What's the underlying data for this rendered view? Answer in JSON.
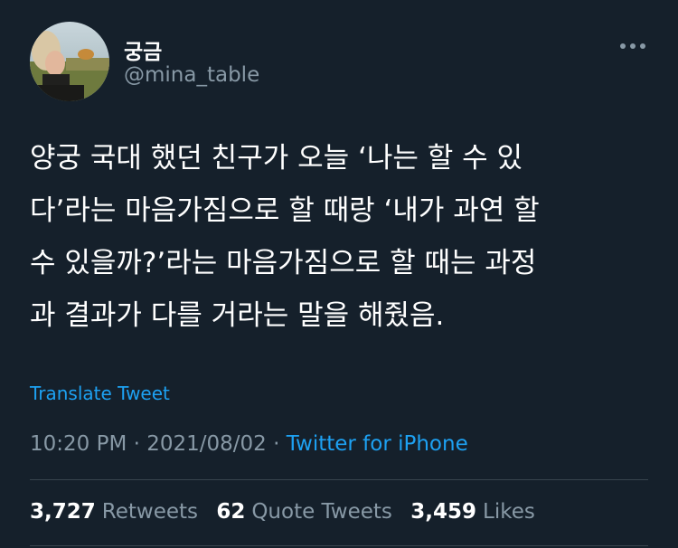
{
  "user": {
    "display_name": "궁금",
    "handle": "@mina_table"
  },
  "tweet": {
    "lines": [
      "양궁 국대 했던 친구가 오늘 ‘나는 할 수 있",
      "다’라는 마음가짐으로 할 때랑 ‘내가 과연 할",
      "수 있을까?’라는 마음가짐으로 할 때는 과정",
      "과 결과가 다를 거라는 말을 해줬음."
    ],
    "translate_label": "Translate Tweet",
    "time": "10:20 PM",
    "date": "2021/08/02",
    "separator": "·",
    "source": "Twitter for iPhone"
  },
  "stats": {
    "retweets_count": "3,727",
    "retweets_label": "Retweets",
    "quotes_count": "62",
    "quotes_label": "Quote Tweets",
    "likes_count": "3,459",
    "likes_label": "Likes"
  },
  "icons": {
    "more": "more-horizontal-icon"
  },
  "colors": {
    "background": "#15202b",
    "text_primary": "#ffffff",
    "text_secondary": "#8899a6",
    "accent": "#1da1f2",
    "divider": "#38444d"
  }
}
